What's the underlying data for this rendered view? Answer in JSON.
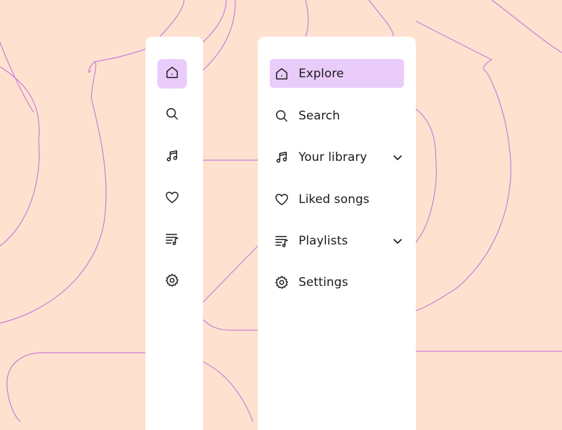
{
  "theme": {
    "accent": "#EACCFA",
    "background": "#FFE1CF",
    "line": "#C77FD9"
  },
  "sidebar_collapsed": {
    "items": [
      {
        "icon": "home-icon",
        "active": true
      },
      {
        "icon": "search-icon",
        "active": false
      },
      {
        "icon": "music-note-icon",
        "active": false
      },
      {
        "icon": "heart-icon",
        "active": false
      },
      {
        "icon": "playlist-icon",
        "active": false
      },
      {
        "icon": "gear-icon",
        "active": false
      }
    ]
  },
  "sidebar_expanded": {
    "items": [
      {
        "label": "Explore",
        "icon": "home-icon",
        "active": true,
        "has_chevron": false
      },
      {
        "label": "Search",
        "icon": "search-icon",
        "active": false,
        "has_chevron": false
      },
      {
        "label": "Your library",
        "icon": "music-note-icon",
        "active": false,
        "has_chevron": true
      },
      {
        "label": "Liked songs",
        "icon": "heart-icon",
        "active": false,
        "has_chevron": false
      },
      {
        "label": "Playlists",
        "icon": "playlist-icon",
        "active": false,
        "has_chevron": true
      },
      {
        "label": "Settings",
        "icon": "gear-icon",
        "active": false,
        "has_chevron": false
      }
    ]
  }
}
